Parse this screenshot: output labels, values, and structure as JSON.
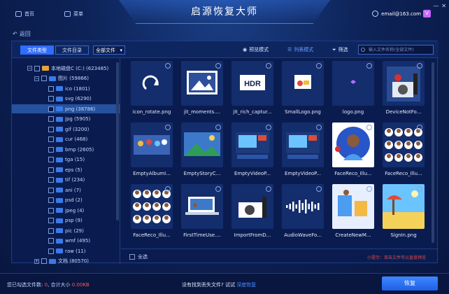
{
  "titlebar": {
    "title": "启源恢复大师",
    "nav_home": "首页",
    "nav_menu": "菜单",
    "user_email": "email@163.com",
    "vip_badge": "V"
  },
  "back_label": "返回",
  "toolbar": {
    "tab_file_type": "文件类型",
    "tab_file_dir": "文件目录",
    "filter_select": "全部文件",
    "preview_mode": "预览模式",
    "list_mode": "列表模式",
    "filter": "筛选",
    "search_placeholder": "输入文件名称(全部文件)"
  },
  "tree": [
    {
      "label": "本地磁盘C (C:) (623485)",
      "level": 0,
      "toggle": "−",
      "kind": "disk"
    },
    {
      "label": "图片 (59866)",
      "level": 1,
      "toggle": "−",
      "kind": "folder"
    },
    {
      "label": "ico (1801)",
      "level": 2,
      "kind": "folder"
    },
    {
      "label": "svg (6290)",
      "level": 2,
      "kind": "folder"
    },
    {
      "label": "png (38786)",
      "level": 2,
      "kind": "folder",
      "selected": true
    },
    {
      "label": "jpg (5905)",
      "level": 2,
      "kind": "folder"
    },
    {
      "label": "gif (3200)",
      "level": 2,
      "kind": "folder"
    },
    {
      "label": "cur (468)",
      "level": 2,
      "kind": "folder"
    },
    {
      "label": "bmp (2605)",
      "level": 2,
      "kind": "folder"
    },
    {
      "label": "tga (15)",
      "level": 2,
      "kind": "folder"
    },
    {
      "label": "eps (5)",
      "level": 2,
      "kind": "folder"
    },
    {
      "label": "tif (234)",
      "level": 2,
      "kind": "folder"
    },
    {
      "label": "ani (7)",
      "level": 2,
      "kind": "folder"
    },
    {
      "label": "psd (2)",
      "level": 2,
      "kind": "folder"
    },
    {
      "label": "jpeg (4)",
      "level": 2,
      "kind": "folder"
    },
    {
      "label": "psp (9)",
      "level": 2,
      "kind": "folder"
    },
    {
      "label": "pic (29)",
      "level": 2,
      "kind": "folder"
    },
    {
      "label": "wmf (495)",
      "level": 2,
      "kind": "folder"
    },
    {
      "label": "raw (11)",
      "level": 2,
      "kind": "folder"
    },
    {
      "label": "文档 (80570)",
      "level": 1,
      "toggle": "+",
      "kind": "folder"
    }
  ],
  "files": [
    {
      "name": "icon_rotate.png",
      "art": "rotate-icon"
    },
    {
      "name": "jit_moments....",
      "art": "image-gallery-icon"
    },
    {
      "name": "jit_rich_captur...",
      "art": "hdr-icon"
    },
    {
      "name": "SmallLogo.png",
      "art": "logo-icon"
    },
    {
      "name": "logo.png",
      "art": "small-glyph-icon"
    },
    {
      "name": "DeviceNotFo...",
      "art": "camera-error-illustration"
    },
    {
      "name": "EmptyAlbumI...",
      "art": "people-illustration"
    },
    {
      "name": "EmptyStoryC...",
      "art": "landscape-illustration"
    },
    {
      "name": "EmptyVideoP...",
      "art": "video-editing-illustration"
    },
    {
      "name": "EmptyVideoP...",
      "art": "video-editing-illustration"
    },
    {
      "name": "FaceReco_Illu...",
      "art": "face-recognition-illustration"
    },
    {
      "name": "FaceReco_Illu...",
      "art": "avatar-grid-illustration"
    },
    {
      "name": "FaceReco_Illu...",
      "art": "avatar-grid-illustration"
    },
    {
      "name": "FirstTimeUse....",
      "art": "laptop-illustration"
    },
    {
      "name": "ImportFromD...",
      "art": "camera-illustration"
    },
    {
      "name": "AudioWaveFo...",
      "art": "waveform-illustration"
    },
    {
      "name": "CreateNewM...",
      "art": "studio-illustration"
    },
    {
      "name": "SignIn.png",
      "art": "beach-illustration"
    }
  ],
  "footer": {
    "select_all": "全选",
    "hint": "小提示：双击文件可以直接预览"
  },
  "status": {
    "selected_prefix": "您已勾选文件数:",
    "selected_count": "0",
    "size_prefix": ", 合计大小",
    "size_value": "0.00KB",
    "lost_prompt": "没有找到丢失文件? 试试",
    "deep_recover": "深度恢复",
    "recover_button": "恢复"
  },
  "colors": {
    "accent": "#2f6cff",
    "hint_red": "#e24a4a",
    "link": "#4a8dff"
  }
}
